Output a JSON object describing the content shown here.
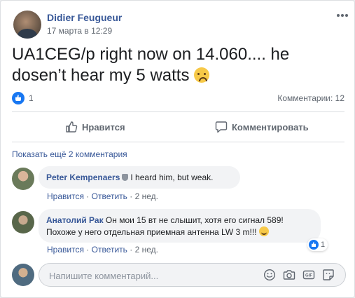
{
  "post": {
    "author": "Didier Feugueur",
    "date": "17 марта в 12:29",
    "text": "UA1CEG/p right now on 14.060.... he dosen’t hear my 5 watts",
    "emoji_icon": "sad-tear-emoji-icon",
    "like_count": "1",
    "comments_count": "Комментарии: 12"
  },
  "actions": {
    "like_label": "Нравится",
    "comment_label": "Комментировать"
  },
  "comments": {
    "show_previous": "Показать ещё 2 комментария",
    "items": [
      {
        "author": "Peter Kempenaers",
        "text": "I heard him, but weak.",
        "like": "Нравится",
        "reply": "Ответить",
        "time": "2 нед.",
        "sep": "·"
      },
      {
        "author": "Анатолий Рак",
        "text_line1": "Он мои 15 вт не слышит, хотя его сигнал 589!",
        "text_line2": "Похоже у него отдельная приемная антенна LW 3 m!!!",
        "like": "Нравится",
        "reply": "Ответить",
        "time": "2 нед.",
        "sep": "·",
        "reaction_count": "1"
      }
    ]
  },
  "composer": {
    "placeholder": "Напишите комментарий...",
    "tools": [
      "emoji-icon",
      "camera-icon",
      "gif-icon",
      "sticker-icon"
    ],
    "gif_label": "GIF"
  },
  "colors": {
    "link": "#385898",
    "like_blue": "#1877f2",
    "muted": "#606770",
    "bubble": "#f2f3f5"
  }
}
